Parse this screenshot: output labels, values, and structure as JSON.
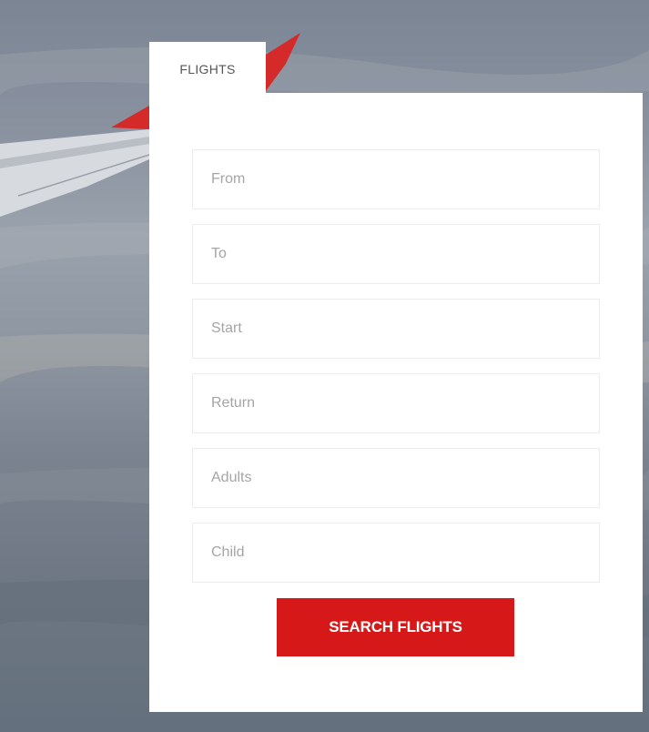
{
  "tab": {
    "label": "FLIGHTS"
  },
  "form": {
    "fields": [
      {
        "placeholder": "From"
      },
      {
        "placeholder": "To"
      },
      {
        "placeholder": "Start"
      },
      {
        "placeholder": "Return"
      },
      {
        "placeholder": "Adults"
      },
      {
        "placeholder": "Child"
      }
    ],
    "submit_label": "SEARCH FLIGHTS"
  },
  "colors": {
    "accent": "#d71818",
    "card": "#ffffff"
  }
}
